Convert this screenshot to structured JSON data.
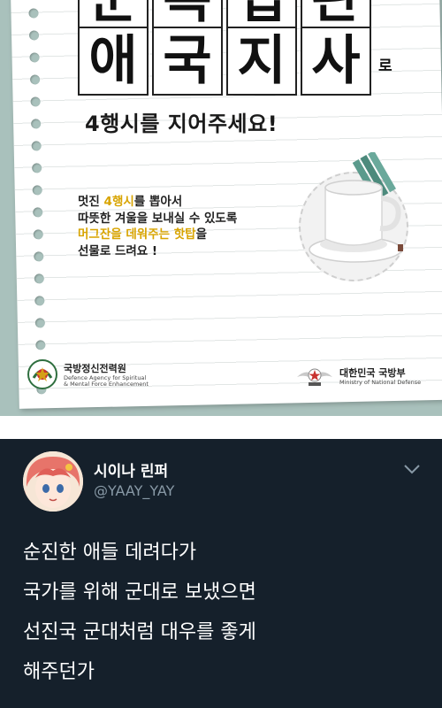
{
  "poster": {
    "title_top_chars": [
      "군",
      "복",
      "입",
      "관"
    ],
    "title_main_chars": [
      "애",
      "국",
      "지",
      "사"
    ],
    "title_suffix": "로",
    "subtitle": "4행시를 지어주세요!",
    "desc": {
      "line1_pre": "멋진 ",
      "line1_hl": "4행시",
      "line1_post": "를 뽑아서",
      "line2": "따뜻한 겨울을 보내실 수 있도록",
      "line3_hl": "머그잔을 데워주는 핫탑",
      "line3_post": "을",
      "line4": "선물로 드려요 !"
    },
    "org_left": {
      "name": "국방정신전력원",
      "sub1": "Defence Agency for Spiritual",
      "sub2": "& Mental Force Enhancement"
    },
    "org_right": {
      "name": "대한민국 국방부",
      "sub": "Ministry of National Defense"
    }
  },
  "tweet": {
    "display_name": "시이나 린퍼",
    "handle": "@YAAY_YAY",
    "lines": [
      "순진한 애들 데려다가",
      "국가를 위해 군대로 보냈으면",
      "선진국 군대처럼 대우를 좋게",
      "해주던가"
    ]
  },
  "colors": {
    "poster_background": "#a9c1bc",
    "highlight": "#d8a400",
    "tweet_background": "#15202b",
    "handle": "#8899a6"
  },
  "icons": [
    "menu-chevron-down-icon",
    "spiritual-agency-logo-icon",
    "mnd-emblem-icon"
  ]
}
